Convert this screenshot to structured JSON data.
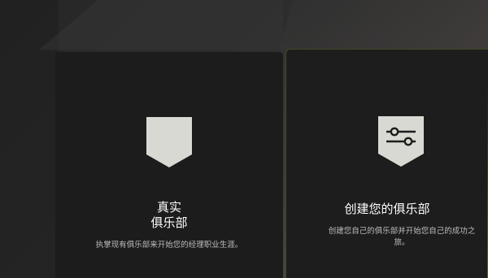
{
  "cards": {
    "real_club": {
      "title_line1": "真实",
      "title_line2": "俱乐部",
      "description": "执掌现有俱乐部来开始您的经理职业生涯。",
      "icon": "shield-icon"
    },
    "create_club": {
      "title": "创建您的俱乐部",
      "description": "创建您自己的俱乐部并开始您自己的成功之旅。",
      "icon": "sliders-shield-icon"
    }
  },
  "colors": {
    "badge_fill": "#d9d9d4",
    "card_bg": "#1d1d1d",
    "accent_border": "#5a6a2a"
  }
}
